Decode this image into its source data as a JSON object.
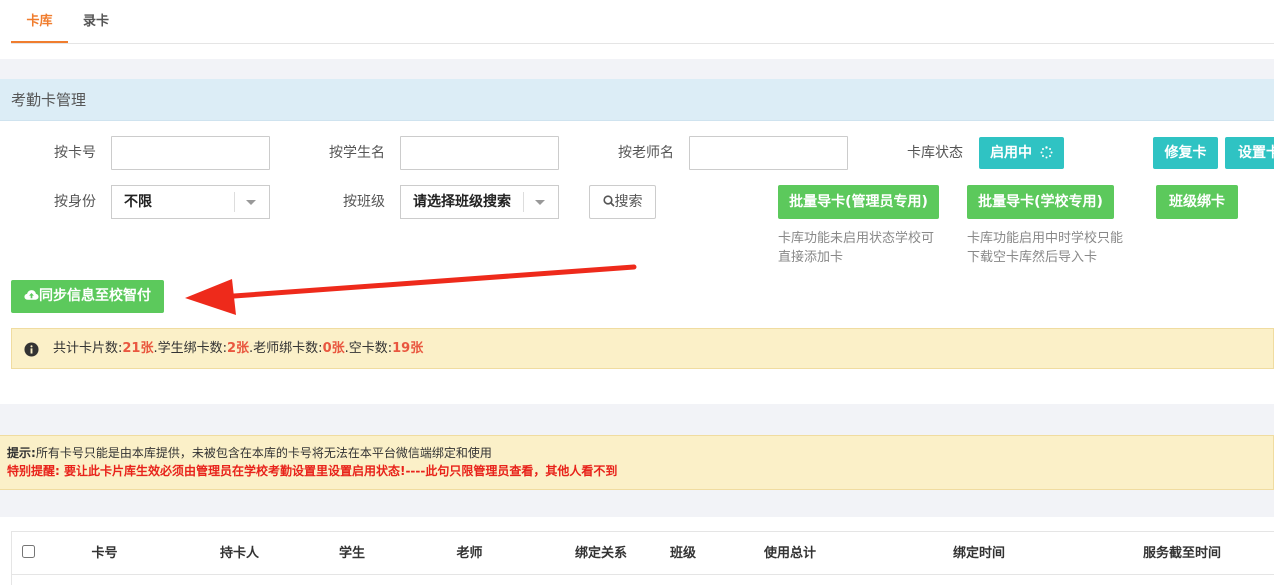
{
  "tabs": [
    {
      "label": "卡库",
      "active": true
    },
    {
      "label": "录卡",
      "active": false
    }
  ],
  "panel": {
    "title": "考勤卡管理"
  },
  "filters": {
    "card_no_label": "按卡号",
    "student_label": "按学生名",
    "teacher_label": "按老师名",
    "status_label": "卡库状态",
    "status_button": "启用中",
    "repair_button": "修复卡",
    "settings_button": "设置卡",
    "identity_label": "按身份",
    "identity_value": "不限",
    "class_label": "按班级",
    "class_value": "请选择班级搜索",
    "search_button": "搜索"
  },
  "actions": {
    "import_admin": "批量导卡(管理员专用)",
    "import_school": "批量导卡(学校专用)",
    "class_bind": "班级绑卡",
    "note_admin_1": "卡库功能未启用状态学校可",
    "note_admin_2": "直接添加卡",
    "note_school_1": "卡库功能启用中时学校只能",
    "note_school_2": "下载空卡库然后导入卡",
    "sync_button": "同步信息至校智付"
  },
  "stats": {
    "total_label": "共计卡片数:",
    "total": "21张",
    "student_label": ".学生绑卡数:",
    "student": "2张",
    "teacher_label": ".老师绑卡数:",
    "teacher": "0张",
    "empty_label": ".空卡数:",
    "empty": "19张"
  },
  "notice": {
    "tip_label": "提示:",
    "tip_text": "所有卡号只能是由本库提供，未被包含在本库的卡号将无法在本平台微信端绑定和使用",
    "warning": "特别提醒: 要让此卡片库生效必须由管理员在学校考勤设置里设置启用状态!----此句只限管理员查看，其他人看不到"
  },
  "table": {
    "headers": [
      "卡号",
      "持卡人",
      "学生",
      "老师",
      "绑定关系",
      "班级",
      "使用总计",
      "绑定时间",
      "服务截至时间"
    ]
  },
  "colors": {
    "accent_orange": "#f07d2e",
    "teal": "#2fc3c3",
    "green": "#5cc95c",
    "red_stat": "#e9573f",
    "warning_red": "#e8231b",
    "panel_head": "#dcedf6",
    "alert_bg": "#fbf0c8"
  },
  "icons": {
    "search": "search-icon",
    "spinner": "spinner-icon",
    "cloud_upload": "cloud-upload-icon",
    "info": "info-icon",
    "arrow_annotation": "red-arrow-annotation"
  }
}
